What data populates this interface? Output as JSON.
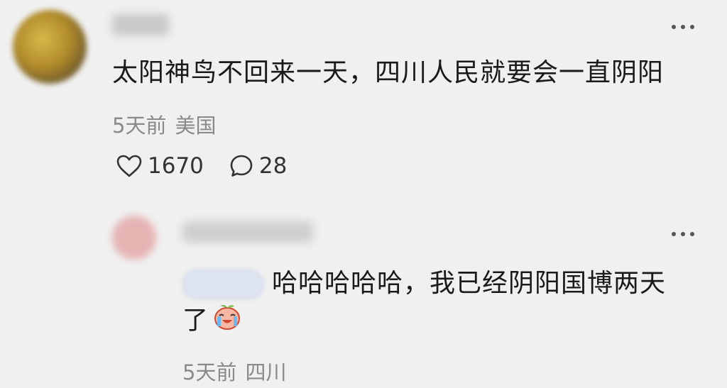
{
  "comment": {
    "author_name": "用户",
    "text": "太阳神鸟不回来一天，四川人民就要会一直阴阳",
    "time": "5天前",
    "location": "美国",
    "like_count": "1670",
    "reply_count": "28",
    "icons": {
      "like": "heart-icon",
      "reply": "comment-bubble-icon",
      "more": "more-icon"
    }
  },
  "reply": {
    "author_name": "用户",
    "mention": "@",
    "text": "哈哈哈哈哈，我已经阴阳国博两天了",
    "emoji": "crying-laughing-peach-emoji",
    "time": "5天前",
    "location": "四川"
  },
  "colors": {
    "background": "#f0f0f0",
    "text": "#1a1a1a",
    "meta": "#8a8a8a"
  }
}
